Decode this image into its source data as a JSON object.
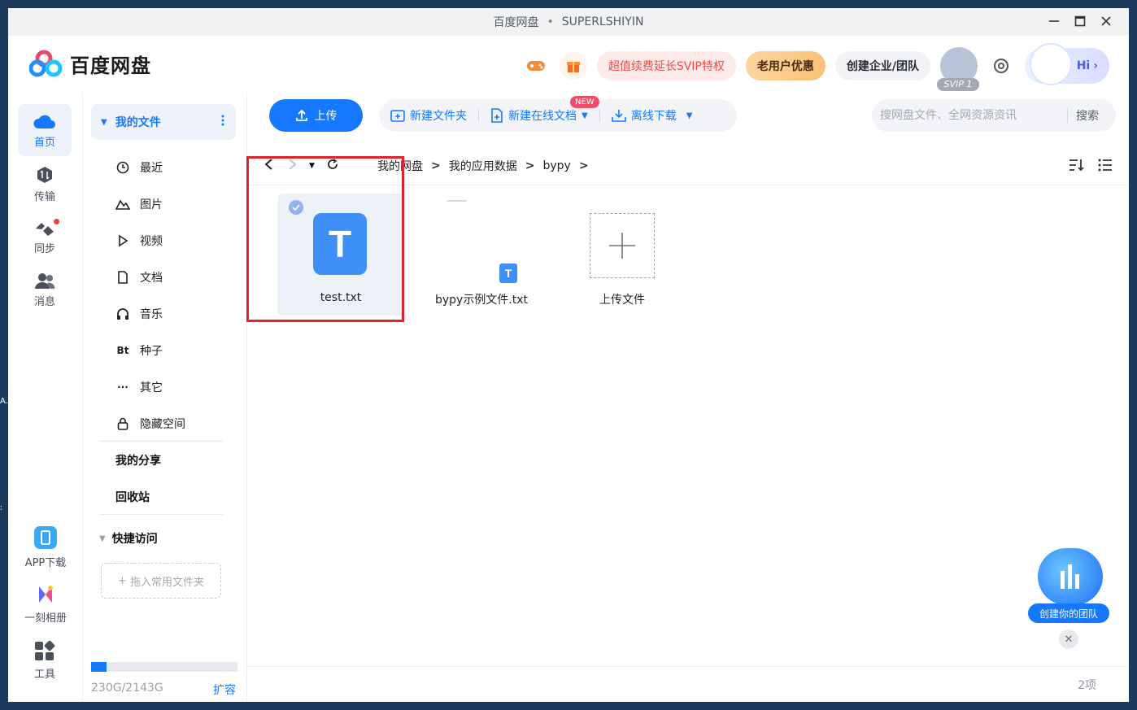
{
  "window": {
    "title": "百度网盘",
    "user": "SUPERLSHIYIN"
  },
  "app": {
    "logo_text": "百度网盘",
    "svip_promo": "超值续费延长SVIP特权",
    "old_user_offer": "老用户优惠",
    "create_team": "创建企业/团队",
    "svip_badge": "SVIP 1",
    "hi_label": "Hi"
  },
  "nav": {
    "home": "首页",
    "transfer": "传输",
    "sync": "同步",
    "messages": "消息",
    "app_download": "APP下载",
    "moment_album": "一刻相册",
    "tools": "工具"
  },
  "sidebar": {
    "my_files": "我的文件",
    "items": [
      {
        "label": "最近",
        "icon": "clock-icon"
      },
      {
        "label": "图片",
        "icon": "image-icon"
      },
      {
        "label": "视频",
        "icon": "play-icon"
      },
      {
        "label": "文档",
        "icon": "document-icon"
      },
      {
        "label": "音乐",
        "icon": "headphones-icon"
      },
      {
        "label": "种子",
        "icon": "bt-icon",
        "glyph": "Bt"
      },
      {
        "label": "其它",
        "icon": "more-icon",
        "glyph": "···"
      },
      {
        "label": "隐藏空间",
        "icon": "lock-icon"
      }
    ],
    "my_share": "我的分享",
    "recycle_bin": "回收站",
    "quick_access": "快捷访问",
    "drop_hint": "拖入常用文件夹",
    "quota_text": "230G/2143G",
    "quota_fraction": 0.107,
    "expand": "扩容"
  },
  "toolbar": {
    "upload": "上传",
    "new_folder": "新建文件夹",
    "new_online_doc": "新建在线文档",
    "new_badge": "NEW",
    "offline_download": "离线下载",
    "search_placeholder": "搜网盘文件、全网资源资讯",
    "search_button": "搜索"
  },
  "breadcrumb": [
    "我的网盘",
    "我的应用数据",
    "bypy"
  ],
  "files": [
    {
      "name": "test.txt",
      "icon_letter": "T",
      "selected": true
    },
    {
      "name": "bypy示例文件.txt",
      "icon_letter": "T",
      "selected": false
    },
    {
      "name": "上传文件"
    }
  ],
  "status": {
    "count": "2项"
  },
  "promo": {
    "label": "创建你的团队",
    "close": "✕"
  },
  "desktop_edge": [
    "A.",
    "∶"
  ],
  "colors": {
    "accent": "#1677ff",
    "highlight": "#e3232b"
  }
}
